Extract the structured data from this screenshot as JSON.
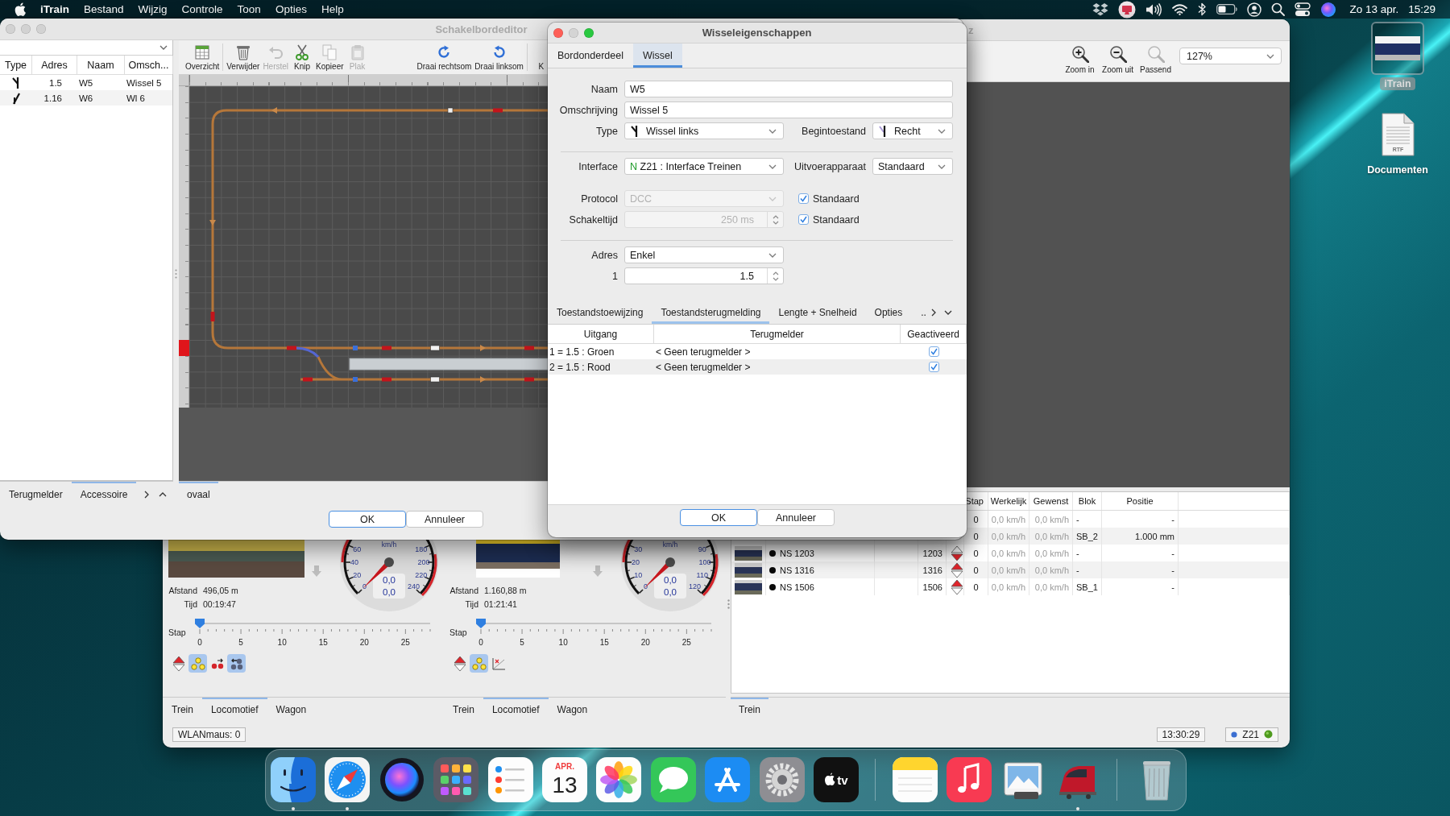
{
  "menubar": {
    "app": "iTrain",
    "menus": [
      "Bestand",
      "Wijzig",
      "Controle",
      "Toon",
      "Opties",
      "Help"
    ],
    "date": "Zo 13 apr.",
    "time": "15:29"
  },
  "desktop_icons": [
    {
      "kind": "app",
      "label": "iTrain",
      "selected": true
    },
    {
      "kind": "document",
      "label": "Documenten",
      "badge": "RTF",
      "selected": false
    }
  ],
  "main_window": {
    "title": "z",
    "toolbar": [
      {
        "kind": "zoom-in",
        "label": "Zoom in"
      },
      {
        "kind": "zoom-out",
        "label": "Zoom uit"
      },
      {
        "kind": "fit",
        "label": "Passend"
      }
    ],
    "zoom_select": "127%",
    "loco_panels": [
      {
        "photo": {
          "kind": "station"
        },
        "distance_label": "Afstand",
        "distance": "496,05 m",
        "time_label": "Tijd",
        "time": "00:19:47",
        "gauge": {
          "unit": "km/h",
          "low_labels": [
            "60",
            "40",
            "20",
            "0"
          ],
          "high_labels": [
            "180",
            "200",
            "220",
            "240"
          ],
          "readouts": [
            "0,0",
            "0,0"
          ]
        },
        "slider": {
          "label": "Stap",
          "ticks": [
            "0",
            "5",
            "10",
            "15",
            "20",
            "25"
          ],
          "level": 0
        },
        "functions": [
          {
            "kind": "direction",
            "on": false
          },
          {
            "kind": "lights",
            "on": true
          },
          {
            "kind": "shunting",
            "on": false
          },
          {
            "kind": "coupling",
            "on": true
          }
        ],
        "tabs": [
          {
            "label": "Trein",
            "selected": false
          },
          {
            "label": "Locomotief",
            "selected": true
          },
          {
            "label": "Wagon",
            "selected": false
          }
        ]
      },
      {
        "photo": {
          "kind": "cutout"
        },
        "distance_label": "Afstand",
        "distance": "1.160,88 m",
        "time_label": "Tijd",
        "time": "01:21:41",
        "gauge": {
          "unit": "km/h",
          "low_labels": [
            "30",
            "20",
            "10",
            "0"
          ],
          "high_labels": [
            "90",
            "100",
            "110",
            "120"
          ],
          "readouts": [
            "0,0",
            "0,0"
          ]
        },
        "slider": {
          "label": "Stap",
          "ticks": [
            "0",
            "5",
            "10",
            "15",
            "20",
            "25"
          ],
          "level": 0
        },
        "functions": [
          {
            "kind": "direction",
            "on": false
          },
          {
            "kind": "lights",
            "on": true
          },
          {
            "kind": "chart",
            "on": false
          }
        ],
        "tabs": [
          {
            "label": "Trein",
            "selected": false
          },
          {
            "label": "Locomotief",
            "selected": true
          },
          {
            "label": "Wagon",
            "selected": false
          }
        ]
      }
    ],
    "train_table": {
      "columns": [
        "Stap",
        "Werkelijk",
        "Gewenst",
        "Blok",
        "Positie"
      ],
      "rows": [
        {
          "step": "0",
          "actual": "0,0 km/h",
          "wanted": "0,0 km/h",
          "block": "-",
          "position": "-"
        },
        {
          "step": "0",
          "actual": "0,0 km/h",
          "wanted": "0,0 km/h",
          "block": "SB_2",
          "position": "1.000 mm"
        },
        {
          "name": "NS 1203",
          "address": "1203",
          "forward": false,
          "step": "0",
          "actual": "0,0 km/h",
          "wanted": "0,0 km/h",
          "block": "-",
          "position": "-"
        },
        {
          "name": "NS 1316",
          "address": "1316",
          "forward": true,
          "step": "0",
          "actual": "0,0 km/h",
          "wanted": "0,0 km/h",
          "block": "-",
          "position": "-"
        },
        {
          "name": "NS 1506",
          "address": "1506",
          "forward": true,
          "step": "0",
          "actual": "0,0 km/h",
          "wanted": "0,0 km/h",
          "block": "SB_1",
          "position": "-"
        }
      ],
      "tabs": [
        {
          "label": "Trein",
          "selected": true
        }
      ]
    },
    "status": {
      "device": "WLANmaus: 0",
      "clock": "13:30:29",
      "connection": "Z21"
    }
  },
  "editor": {
    "title": "Schakelbordeditor",
    "list": {
      "columns": [
        "Type",
        "Adres",
        "Naam",
        "Omsch..."
      ],
      "rows": [
        {
          "kind": "left",
          "address": "1.5",
          "name": "W5",
          "description": "Wissel 5"
        },
        {
          "kind": "right",
          "address": "1.16",
          "name": "W6",
          "description": "Wl 6"
        }
      ]
    },
    "list_tabs": [
      {
        "label": "Terugmelder",
        "selected": false
      },
      {
        "label": "Accessoire",
        "selected": true
      }
    ],
    "toolbar": [
      {
        "kind": "table",
        "label": "Overzicht",
        "disabled": false
      },
      {
        "kind": "trash",
        "label": "Verwijder",
        "disabled": false
      },
      {
        "kind": "undo",
        "label": "Herstel",
        "disabled": true
      },
      {
        "kind": "scissors",
        "label": "Knip",
        "disabled": false
      },
      {
        "kind": "copy",
        "label": "Kopieer",
        "disabled": false
      },
      {
        "kind": "paste",
        "label": "Plak",
        "disabled": true
      },
      {
        "kind": "rotate-right",
        "label": "Draai rechtsom",
        "disabled": false
      },
      {
        "kind": "rotate-left",
        "label": "Draai linksom",
        "disabled": false
      },
      {
        "kind": "cut-off",
        "label": "K",
        "disabled": false
      }
    ],
    "sheet_tabs": [
      {
        "label": "ovaal",
        "selected": true
      }
    ],
    "buttons": [
      {
        "label": "OK",
        "default": true
      },
      {
        "label": "Annuleer",
        "default": false
      }
    ]
  },
  "dialog": {
    "title": "Wisseleigenschappen",
    "tabs": [
      {
        "label": "Bordonderdeel",
        "selected": false
      },
      {
        "label": "Wissel",
        "selected": true
      }
    ],
    "name": {
      "label": "Naam",
      "value": "W5"
    },
    "description": {
      "label": "Omschrijving",
      "value": "Wissel 5"
    },
    "type": {
      "label": "Type",
      "value": "Wissel links"
    },
    "initial_state": {
      "label": "Begintoestand",
      "value": "Recht"
    },
    "interface": {
      "label": "Interface",
      "prefix": "N",
      "value": "Z21 : Interface Treinen"
    },
    "output_device": {
      "label": "Uitvoerapparaat",
      "value": "Standaard"
    },
    "protocol": {
      "label": "Protocol",
      "value": "DCC",
      "disabled": true,
      "default_option": {
        "label": "Standaard",
        "checked": true
      }
    },
    "switch_time": {
      "label": "Schakeltijd",
      "value": "250 ms",
      "disabled": true,
      "default_option": {
        "label": "Standaard",
        "checked": true
      }
    },
    "address_mode": {
      "label": "Adres",
      "value": "Enkel"
    },
    "address": {
      "label": "1",
      "value": "1.5",
      "disabled": false
    },
    "sub_tabs": [
      {
        "label": "Toestandstoewijzing",
        "selected": false
      },
      {
        "label": "Toestandsterugmelding",
        "selected": true
      },
      {
        "label": "Lengte + Snelheid",
        "selected": false
      },
      {
        "label": "Opties",
        "selected": false
      }
    ],
    "more_tabs": "..",
    "feedback_table": {
      "columns": [
        "Uitgang",
        "Terugmelder",
        "Geactiveerd"
      ],
      "rows": [
        {
          "output": "1 = 1.5 : Groen",
          "sensor": "< Geen terugmelder >",
          "active": true
        },
        {
          "output": "2 = 1.5 : Rood",
          "sensor": "< Geen terugmelder >",
          "active": true
        }
      ]
    },
    "buttons": [
      {
        "label": "OK",
        "default": true
      },
      {
        "label": "Annuleer",
        "default": false
      }
    ]
  },
  "dock": {
    "sections": [
      {
        "items": [
          {
            "kind": "finder",
            "running": true
          },
          {
            "kind": "safari",
            "running": true
          },
          {
            "kind": "siri",
            "running": false
          },
          {
            "kind": "launchpad",
            "running": false
          },
          {
            "kind": "reminders",
            "running": false
          },
          {
            "kind": "calendar",
            "month": "APR.",
            "day": "13",
            "running": false
          },
          {
            "kind": "photos",
            "running": false
          },
          {
            "kind": "messages",
            "running": false
          },
          {
            "kind": "appstore",
            "running": false
          },
          {
            "kind": "settings",
            "running": false
          },
          {
            "kind": "tv",
            "text": "tv",
            "running": false
          }
        ]
      },
      {
        "items": [
          {
            "kind": "notes",
            "running": false
          },
          {
            "kind": "music",
            "running": false
          },
          {
            "kind": "preview",
            "running": false
          },
          {
            "kind": "itrain",
            "running": true
          }
        ]
      },
      {
        "items": [
          {
            "kind": "trash",
            "running": false
          }
        ]
      }
    ]
  }
}
